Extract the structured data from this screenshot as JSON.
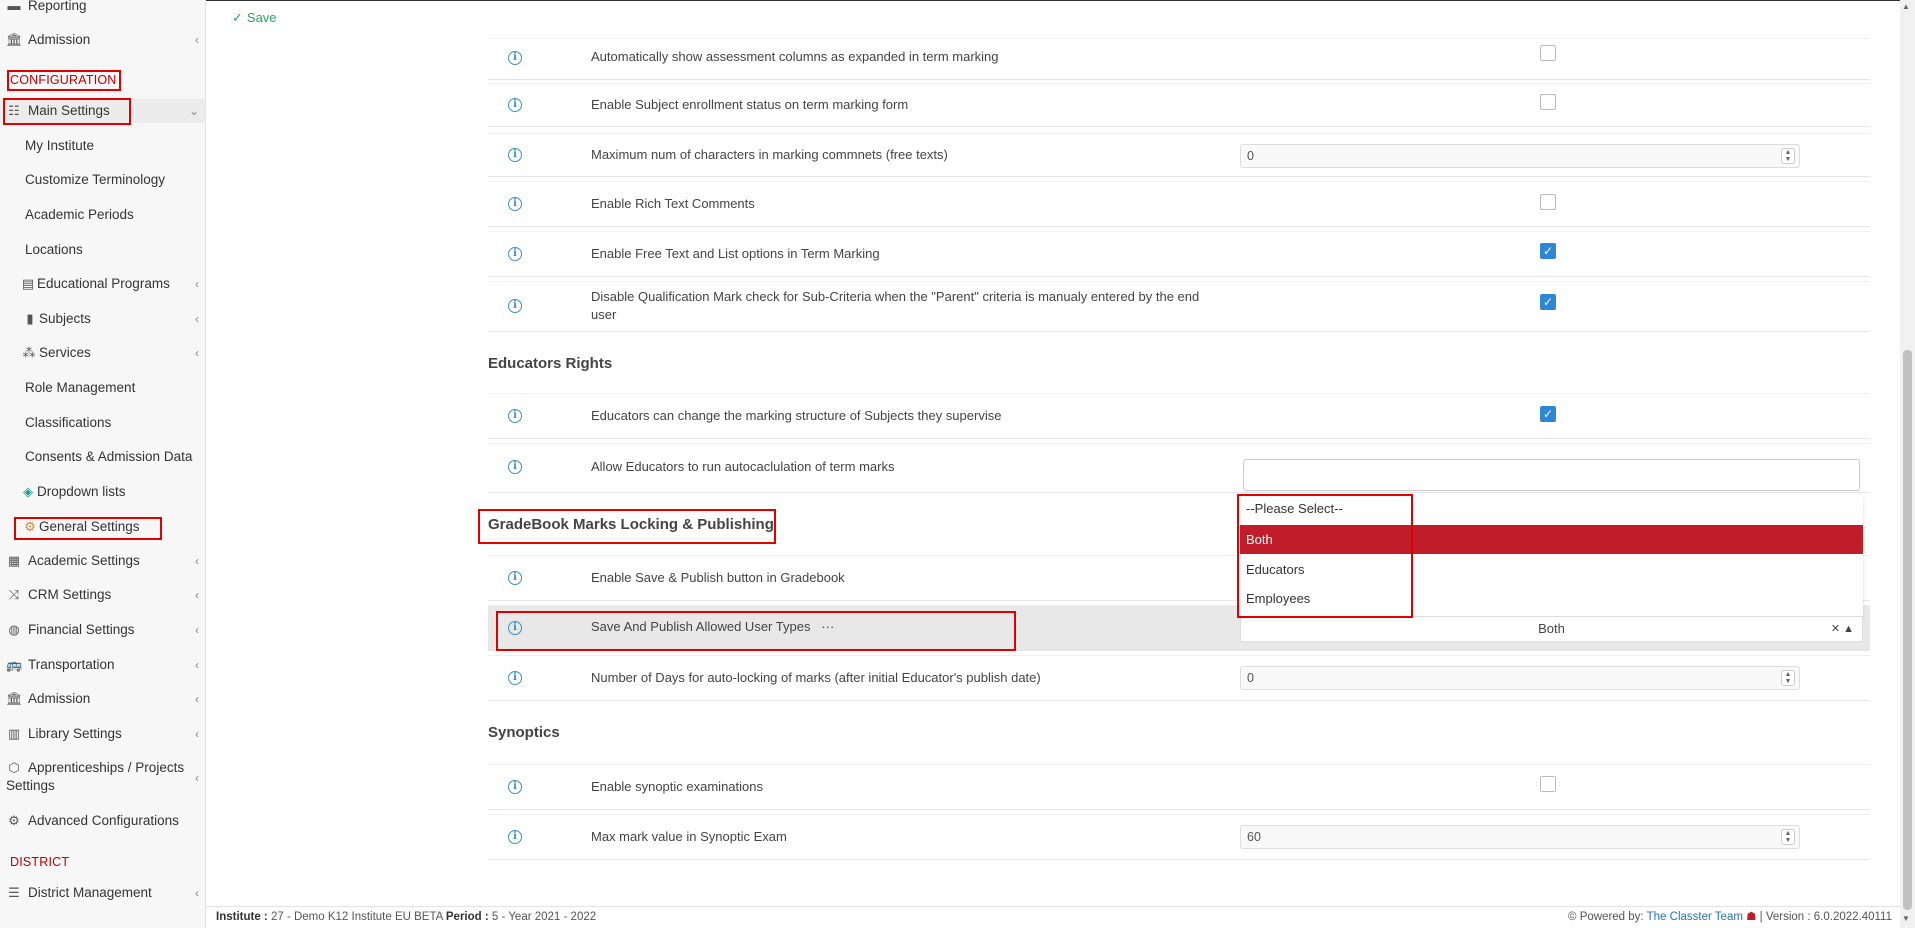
{
  "toolbar": {
    "save_label": "Save"
  },
  "sidebar": {
    "reporting": "Reporting",
    "admission_top": "Admission",
    "config_section": "CONFIGURATION",
    "main_settings": "Main Settings",
    "items": [
      "My Institute",
      "Customize Terminology",
      "Academic Periods",
      "Locations",
      "Educational Programs",
      "Subjects",
      "Services",
      "Role Management",
      "Classifications",
      "Consents & Admission Data",
      "Dropdown lists",
      "General Settings"
    ],
    "groups": [
      "Academic Settings",
      "CRM Settings",
      "Financial Settings",
      "Transportation",
      "Admission",
      "Library Settings",
      "Apprenticeships / Projects Settings",
      "Advanced Configurations"
    ],
    "district_section": "DISTRICT",
    "district_management": "District Management"
  },
  "rows": {
    "r1": "Automatically show assessment columns as expanded in term marking",
    "r2": "Enable Subject enrollment status on term marking form",
    "r3": "Maximum num of characters in marking commnets (free texts)",
    "r3_value": "0",
    "r4": "Enable Rich Text Comments",
    "r5": "Enable Free Text and List options in Term Marking",
    "r6": "Disable Qualification Mark check for Sub-Criteria when the \"Parent\" criteria is manualy entered by the end user",
    "educators_title": "Educators Rights",
    "r7": "Educators can change the marking structure of Subjects they supervise",
    "r8": "Allow Educators to run autocaclulation of term marks",
    "gradebook_title": "GradeBook Marks Locking & Publishing",
    "r9": "Enable Save & Publish button in Gradebook",
    "r10": "Save And Publish Allowed User Types",
    "r10_more": "···",
    "r10_value": "Both",
    "r11": "Number of Days for auto-locking of marks (after initial Educator's publish date)",
    "r11_value": "0",
    "synoptics_title": "Synoptics",
    "r12": "Enable synoptic examinations",
    "r13": "Max mark value in Synoptic Exam",
    "r13_value": "60"
  },
  "dropdown": {
    "options": [
      "--Please Select--",
      "Both",
      "Educators",
      "Employees"
    ],
    "selected": "Both"
  },
  "footer": {
    "institute_label": "Institute :",
    "institute_value": "27 - Demo K12 Institute EU BETA",
    "period_label": "Period :",
    "period_value": "5 - Year 2021 - 2022",
    "powered": "Powered by:",
    "team": "The Classter Team",
    "version": "| Version : 6.0.2022.40111"
  },
  "colors": {
    "accent_red": "#c01d2b",
    "checkbox_blue": "#2d87d6",
    "save_green": "#27a365",
    "info_blue": "#3a8ecb"
  }
}
